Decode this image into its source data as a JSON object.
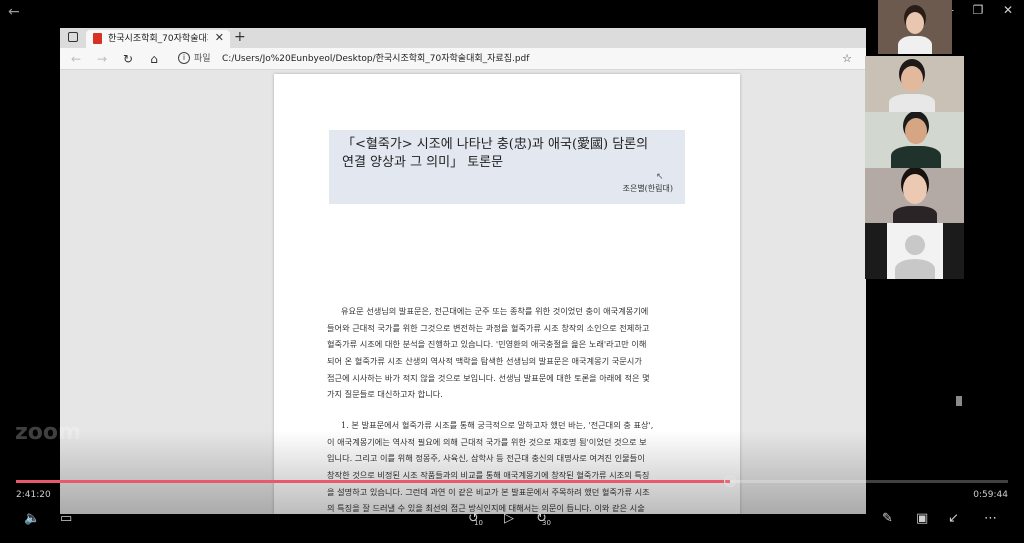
{
  "player": {
    "watermark": "zoom",
    "time_current": "2:41:20",
    "time_total": "0:59:44",
    "progress": 0.72,
    "skip_back": "10",
    "skip_forward": "30"
  },
  "browser": {
    "tab_title": "한국시조학회_70자학술대회_자",
    "url_scheme": "파일",
    "url": "C:/Users/Jo%20Eunbyeol/Desktop/한국시조학회_70자학술대회_자료집.pdf"
  },
  "document": {
    "title_line1": "「<혈죽가> 시조에 나타난 충(忠)과 애국(愛國) 담론의",
    "title_line2": "연결 양상과 그 의미」 토론문",
    "author": "조은별(한림대)",
    "paragraph1": [
      "유요문 선생님의 발표문은, 전근대에는 군주 또는 종착를 위한 것이었던 충이 애국계몽기에",
      "들어와 근대적 국가를 위한 그것으로 변전하는 과정을 혈죽가류 시조 창작의 소인으로 전제하고",
      "혈죽가류 시조에 대한 분석을 진행하고 있습니다. '민영환의 애국충절을 읊은 노래'라고만 이해",
      "되어 온 혈죽가류 시조 산생의 역사적 맥락을 탐색한 선생님의 발표문은 애국계몽기 국문시가",
      "접근에 시사하는 바가 적지 않을 것으로 보입니다. 선생님 발표문에 대한 토론을 아래에 적은 몇",
      "가지 질문들로 대신하고자 합니다."
    ],
    "paragraph2": [
      "1. 본 발표문에서 혈죽가류 시조를 통해 궁극적으로 말하고자 했던 바는, '전근대의 충 표상',",
      "이 애국계몽기에는 역사적 필요에 의해 근대적 국가를 위한 것으로 재호명 됨'이었던 것으로 보",
      "입니다. 그리고 이를 위해 정몽주, 사육신, 삼학사 등 전근대 충신의 대명사로 여겨진 인물들이",
      "창작한 것으로 비정된 시조 작품들과의 비교를 통해 애국계몽기에 창작된 혈죽가류 시조의 특징",
      "을 설명하고 있습니다. 그런데 과연 이 같은 비교가 본 발표문에서 주목하려 했던 혈죽가류 시조",
      "의 특징을 잘 드러낼 수 있을 최선의 접근 방식인지에 대해서는 의문이 듭니다. 이와 같은 시술"
    ]
  },
  "participants": [
    {
      "name": "participant-1",
      "bg": "#6d5a4f",
      "skin": "#e8c6b0",
      "hair": "#2a1d17",
      "shirt": "#f0f0f0"
    },
    {
      "name": "participant-2",
      "bg": "#c9c1b6",
      "skin": "#e2b99d",
      "hair": "#1e1a18",
      "shirt": "#e8e8e8"
    },
    {
      "name": "participant-3",
      "bg": "#d2d7d0",
      "skin": "#d6a584",
      "hair": "#1b1b1b",
      "shirt": "#20322c"
    },
    {
      "name": "participant-4",
      "bg": "#b3aaa6",
      "skin": "#ecc9b3",
      "hair": "#171210",
      "shirt": "#2a2426"
    }
  ],
  "colors": {
    "progress": "#e85a6b",
    "title_box": "#e2e7f0",
    "avatar_bg": "#f2f2f2",
    "avatar_fg": "#c8c8c8"
  }
}
